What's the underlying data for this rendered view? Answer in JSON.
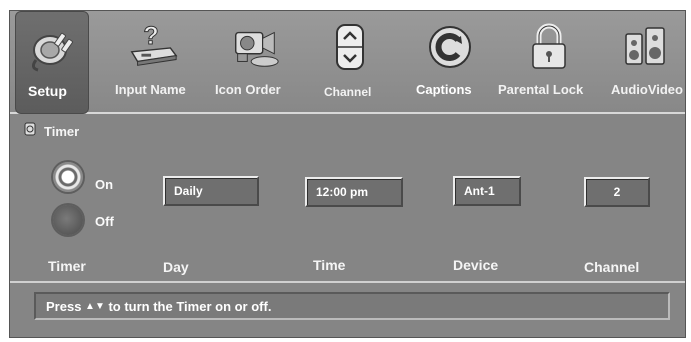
{
  "toolbar": {
    "items": [
      {
        "label": "Setup",
        "icon": "plug-icon",
        "active": true
      },
      {
        "label": "Input Name",
        "icon": "input-name-icon"
      },
      {
        "label": "Icon Order",
        "icon": "camera-icon"
      },
      {
        "label": "Channel",
        "icon": "channel-arrows-icon"
      },
      {
        "label": "Captions",
        "icon": "captions-icon"
      },
      {
        "label": "Parental Lock",
        "icon": "padlock-icon"
      },
      {
        "label": "AudioVideo",
        "icon": "speakers-icon"
      }
    ]
  },
  "timer": {
    "title": "Timer",
    "on_label": "On",
    "off_label": "Off",
    "selected": "On",
    "day": "Daily",
    "time": "12:00 pm",
    "device": "Ant-1",
    "channel": "2",
    "columns": {
      "timer": "Timer",
      "day": "Day",
      "time": "Time",
      "device": "Device",
      "channel": "Channel"
    }
  },
  "status": {
    "prefix": "Press",
    "arrows": "▲▼",
    "suffix": "to turn the Timer on or off."
  },
  "colors": {
    "panel": "#858585",
    "toolbar": "#8f8f8f",
    "field": "#6f6f6f",
    "text": "#ffffff"
  }
}
